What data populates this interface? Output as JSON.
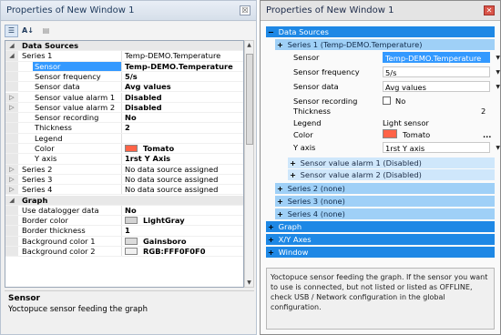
{
  "left": {
    "title": "Properties of New Window 1",
    "close_glyph": "☒",
    "toolbar": {
      "categorized_icon": "categorized-icon",
      "alpha_icon": "sort-az-icon",
      "pages_icon": "property-pages-icon",
      "alpha_label": "A↓"
    },
    "rows": [
      {
        "type": "cat",
        "glyph": "◢",
        "name": "Data Sources",
        "value": ""
      },
      {
        "type": "prop",
        "glyph": "◢",
        "name": "Series 1",
        "value": "Temp-DEMO.Temperature",
        "indent": 1
      },
      {
        "type": "prop",
        "glyph": "",
        "name": "Sensor",
        "value": "Temp-DEMO.Temperature",
        "indent": 2,
        "bold": true,
        "selected": true
      },
      {
        "type": "prop",
        "glyph": "",
        "name": "Sensor frequency",
        "value": "5/s",
        "indent": 2,
        "bold": true
      },
      {
        "type": "prop",
        "glyph": "",
        "name": "Sensor data",
        "value": "Avg values",
        "indent": 2,
        "bold": true
      },
      {
        "type": "prop",
        "glyph": "▷",
        "name": "Sensor value alarm 1",
        "value": "Disabled",
        "indent": 2,
        "bold": true
      },
      {
        "type": "prop",
        "glyph": "▷",
        "name": "Sensor value alarm 2",
        "value": "Disabled",
        "indent": 2,
        "bold": true
      },
      {
        "type": "prop",
        "glyph": "",
        "name": "Sensor recording",
        "value": "No",
        "indent": 2,
        "bold": true
      },
      {
        "type": "prop",
        "glyph": "",
        "name": "Thickness",
        "value": "2",
        "indent": 2,
        "bold": true
      },
      {
        "type": "prop",
        "glyph": "",
        "name": "Legend",
        "value": "",
        "indent": 2
      },
      {
        "type": "prop",
        "glyph": "",
        "name": "Color",
        "value": "Tomato",
        "indent": 2,
        "bold": true,
        "swatch": "#ff6347"
      },
      {
        "type": "prop",
        "glyph": "",
        "name": "Y axis",
        "value": "1rst Y Axis",
        "indent": 2,
        "bold": true
      },
      {
        "type": "prop",
        "glyph": "▷",
        "name": "Series 2",
        "value": "No data source assigned",
        "indent": 1
      },
      {
        "type": "prop",
        "glyph": "▷",
        "name": "Series 3",
        "value": "No data source assigned",
        "indent": 1
      },
      {
        "type": "prop",
        "glyph": "▷",
        "name": "Series 4",
        "value": "No data source assigned",
        "indent": 1
      },
      {
        "type": "cat",
        "glyph": "◢",
        "name": "Graph",
        "value": ""
      },
      {
        "type": "prop",
        "glyph": "",
        "name": "Use datalogger data",
        "value": "No",
        "indent": 1,
        "bold": true
      },
      {
        "type": "prop",
        "glyph": "",
        "name": "Border color",
        "value": "LightGray",
        "indent": 1,
        "bold": true,
        "swatch": "#d3d3d3"
      },
      {
        "type": "prop",
        "glyph": "",
        "name": "Border thickness",
        "value": "1",
        "indent": 1,
        "bold": true
      },
      {
        "type": "prop",
        "glyph": "",
        "name": "Background color 1",
        "value": "Gainsboro",
        "indent": 1,
        "bold": true,
        "swatch": "#dcdcdc"
      },
      {
        "type": "prop",
        "glyph": "",
        "name": "Background color 2",
        "value": "RGB:FFF0F0F0",
        "indent": 1,
        "bold": true,
        "swatch": "#f0f0f0"
      }
    ],
    "desc_title": "Sensor",
    "desc_text": "Yoctopuce sensor feeding the graph"
  },
  "right": {
    "title": "Properties of New Window 1",
    "close_glyph": "✕",
    "data_sources": "Data Sources",
    "series1": "Series 1 (Temp-DEMO.Temperature)",
    "props": {
      "sensor_label": "Sensor",
      "sensor_value": "Temp-DEMO.Temperature",
      "freq_label": "Sensor frequency",
      "freq_value": "5/s",
      "data_label": "Sensor data",
      "data_value": "Avg values",
      "rec_label": "Sensor recording",
      "rec_value": "No",
      "thick_label": "Thickness",
      "thick_value": "2",
      "legend_label": "Legend",
      "legend_value": "Light sensor",
      "color_label": "Color",
      "color_value": "Tomato",
      "color_swatch": "#ff6347",
      "color_more": "...",
      "yaxis_label": "Y axis",
      "yaxis_value": "1rst Y axis"
    },
    "alarm1": "Sensor value alarm 1 (Disabled)",
    "alarm2": "Sensor value alarm 2 (Disabled)",
    "series2": "Series 2 (none)",
    "series3": "Series 3 (none)",
    "series4": "Series 4 (none)",
    "graph": "Graph",
    "xy_axes": "X/Y Axes",
    "window": "Window",
    "minus": "−",
    "plus": "+",
    "dd_arrow": "▼",
    "description": "Yoctopuce sensor feeding the graph. If the sensor you want to use is connected, but not listed or listed as OFFLINE, check USB / Network configuration in the global configuration."
  }
}
